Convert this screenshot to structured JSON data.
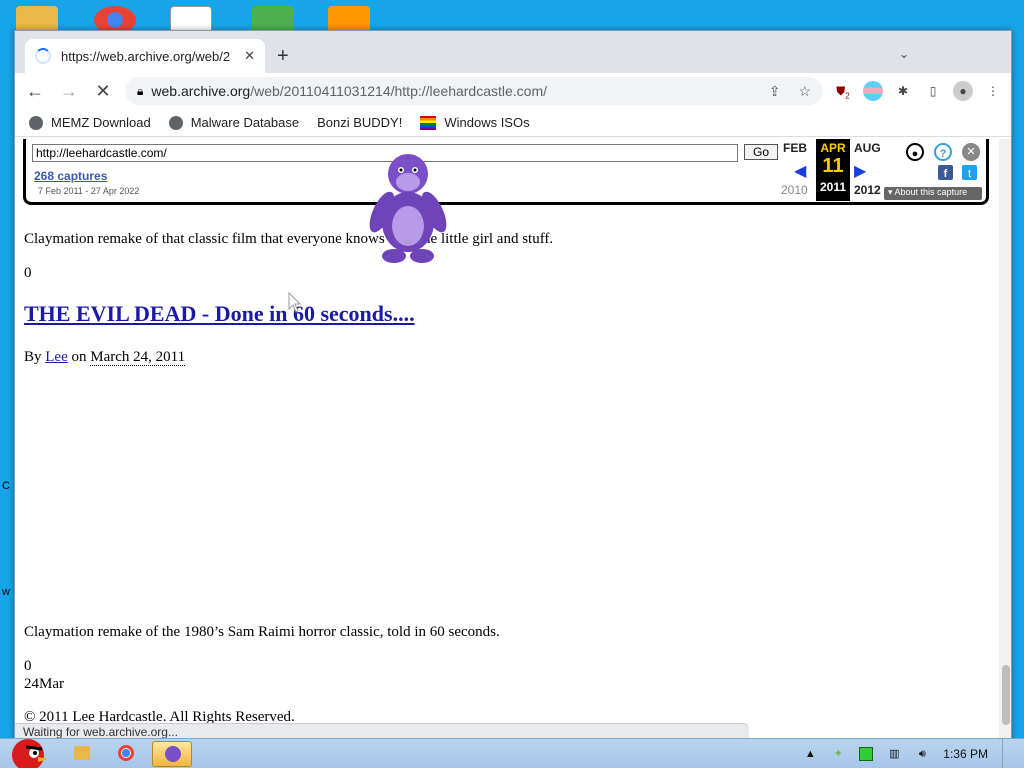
{
  "browser": {
    "tab_title": "https://web.archive.org/web/2",
    "url_domain": "web.archive.org",
    "url_path": "/web/20110411031214/http://leehardcastle.com/",
    "status_text": "Waiting for web.archive.org...",
    "extension_badge": "2"
  },
  "bookmarks": [
    {
      "label": "MEMZ Download",
      "icon": "globe-icon"
    },
    {
      "label": "Malware Database",
      "icon": "globe-icon"
    },
    {
      "label": "Bonzi BUDDY!",
      "icon": "bonzi-icon"
    },
    {
      "label": "Windows ISOs",
      "icon": "rainbow-flag-icon"
    }
  ],
  "wayback": {
    "url_value": "http://leehardcastle.com/",
    "go_label": "Go",
    "captures": "268 captures",
    "range": "7 Feb 2011 - 27 Apr 2022",
    "prev_month": "FEB",
    "prev_year": "2010",
    "cur_month": "APR",
    "cur_day": "11",
    "cur_year": "2011",
    "next_month": "AUG",
    "next_year": "2012",
    "about": "About this capture"
  },
  "page": {
    "para1": "Claymation remake of that classic film that everyone knows with the little girl and stuff.",
    "count1": "0",
    "post_title": "THE EVIL DEAD - Done in 60 seconds....",
    "by_prefix": "By",
    "author": "Lee",
    "on_text": "on",
    "date": "March 24, 2011",
    "para2": "Claymation remake of the 1980’s Sam Raimi horror classic, told in 60 seconds.",
    "count2": "0",
    "date_short": "24Mar",
    "footer": "© 2011 Lee Hardcastle. All Rights Reserved."
  },
  "taskbar": {
    "clock": "1:36 PM"
  },
  "desktop": {
    "left_c": "C",
    "left_w": "w"
  }
}
